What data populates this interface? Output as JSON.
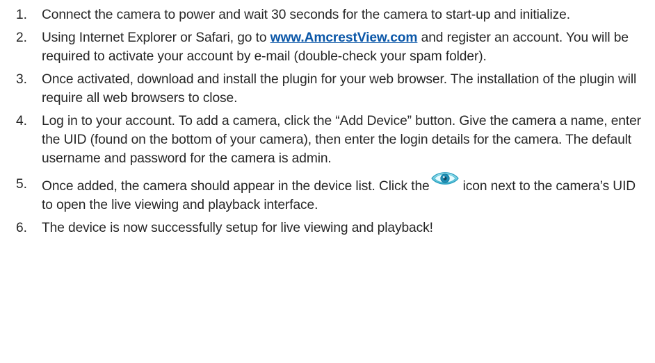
{
  "steps": [
    {
      "number": "1.",
      "text": "Connect the camera to power and wait 30 seconds for the camera to start-up and initialize."
    },
    {
      "number": "2.",
      "text_before": "Using Internet Explorer or Safari, go to ",
      "link": "www.AmcrestView.com",
      "text_after": " and register an account. You will be required to activate your account by e-mail (double-check your spam folder)."
    },
    {
      "number": "3.",
      "text": "Once activated, download and install the plugin for your web browser. The installation of the plugin will require all web browsers to close."
    },
    {
      "number": "4.",
      "text": "Log in to your account. To add a camera, click the “Add Device” button. Give the camera a name, enter the UID (found on the bottom of your camera), then enter the login details for the camera. The default username and password for the camera is admin."
    },
    {
      "number": "5.",
      "text_before": "Once added, the camera should appear in the device list. Click the",
      "icon": "eye-icon",
      "text_after": "icon next to the camera’s UID to open the live viewing and playback interface."
    },
    {
      "number": "6.",
      "text": "The device is now successfully setup for live viewing and playback!"
    }
  ],
  "colors": {
    "text": "#262626",
    "link": "#0b57a8",
    "icon_outer": "#5ec6d8",
    "icon_inner": "#1f8fb5"
  }
}
